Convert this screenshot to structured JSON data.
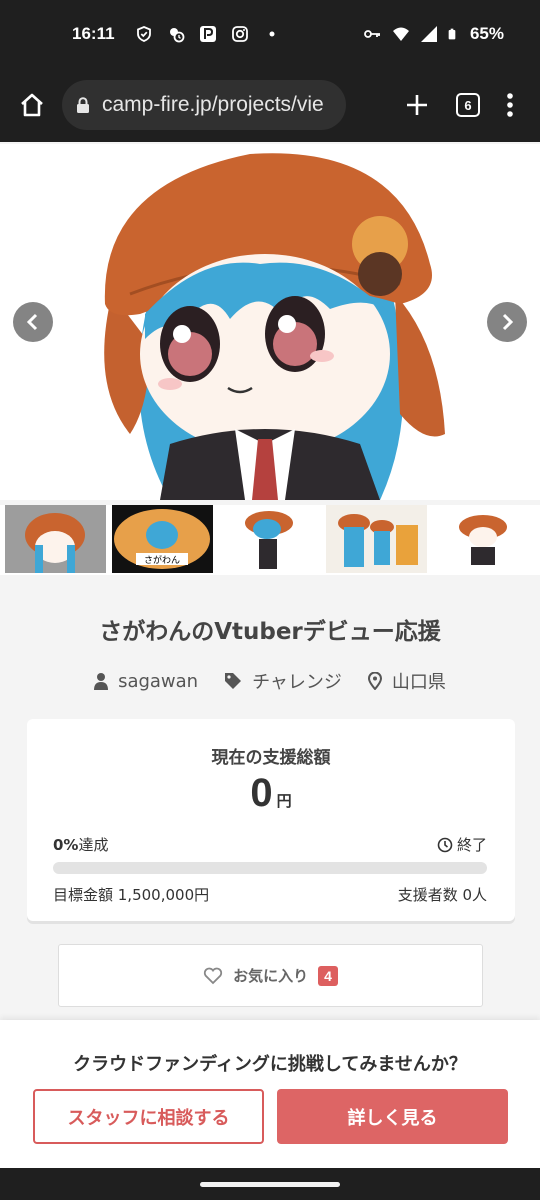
{
  "status_bar": {
    "time": "16:11",
    "battery": "65%",
    "left_icons": [
      "shield-icon",
      "weather-icon",
      "parking-app-icon",
      "instagram-icon",
      "dot-icon"
    ],
    "right_icons": [
      "key-icon",
      "wifi-icon",
      "signal-icon",
      "battery-icon"
    ]
  },
  "browser": {
    "url": "camp-fire.jp/projects/vie",
    "tab_count": "6"
  },
  "gallery": {
    "thumbnail_count": 5
  },
  "project": {
    "title": "さがわんのVtuberデビュー応援",
    "owner": "sagawan",
    "category": "チャレンジ",
    "location": "山口県"
  },
  "funding": {
    "heading": "現在の支援総額",
    "amount": "0",
    "unit": "円",
    "percent": "0%",
    "achieved_label": "達成",
    "progress": 0,
    "status": "終了",
    "goal_label": "目標金額 1,500,000円",
    "backers_label": "支援者数 0人"
  },
  "favorite": {
    "label": "お気に入り",
    "count": "4"
  },
  "promo": {
    "text": "クラウドファンディングに挑戦してみませんか？",
    "consult_label": "スタッフに相談する",
    "more_label": "詳しく見る"
  },
  "colors": {
    "accent": "#dd5f5f",
    "dark_bar": "#1f1f1f",
    "page_bg": "#f4f4f4"
  }
}
